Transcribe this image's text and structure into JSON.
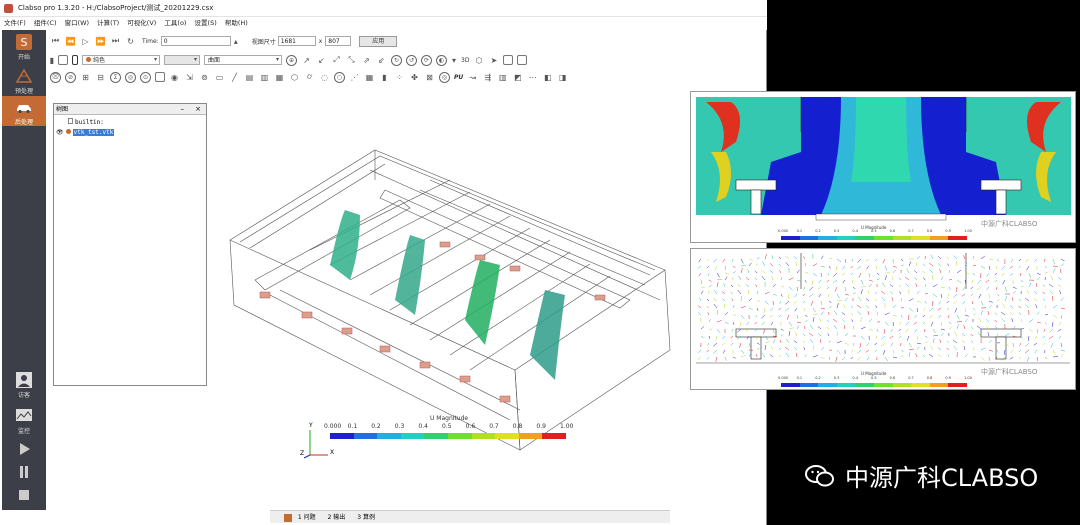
{
  "window": {
    "title": "Clabso pro 1.3.20 - H:/ClabsoProject/测试_20201229.csx"
  },
  "menu": [
    "文件(F)",
    "组件(C)",
    "窗口(W)",
    "计算(T)",
    "可视化(V)",
    "工具(o)",
    "设置(S)",
    "帮助(H)"
  ],
  "dock": {
    "items": [
      {
        "label": "开始",
        "icon": "logo-icon"
      },
      {
        "label": "预处理",
        "icon": "mesh-icon"
      },
      {
        "label": "后处理",
        "icon": "car-icon"
      },
      {
        "label": "访客",
        "icon": "user-icon"
      },
      {
        "label": "监控",
        "icon": "monitor-icon"
      }
    ],
    "active_index": 2
  },
  "toolbar": {
    "time_label": "Time:",
    "time_value": "0",
    "viewsize_label": "视图尺寸",
    "width_value": "1681",
    "x_label": "x",
    "height_value": "807",
    "apply_label": "应用",
    "color_mode": "纯色",
    "surface_mode": "曲面",
    "view3d_label": "3D",
    "pu_label": "PU"
  },
  "tree": {
    "title": "树图",
    "minimize": "–",
    "close": "×",
    "items": [
      "builtin:",
      "vtk_tst.vtk"
    ]
  },
  "colorbar": {
    "title": "U Magnitude",
    "ticks": [
      "0.000",
      "0.1",
      "0.2",
      "0.3",
      "0.4",
      "0.5",
      "0.6",
      "0.7",
      "0.8",
      "0.9",
      "1.00"
    ],
    "colors": [
      "#1f1fd0",
      "#1f6fe0",
      "#20b0e0",
      "#20d0c0",
      "#30d070",
      "#70e030",
      "#b0e020",
      "#e0e020",
      "#f0a020",
      "#e02020"
    ]
  },
  "axes": {
    "y": "Y",
    "z": "Z",
    "x": "X"
  },
  "statusbar": {
    "items": [
      "1 问题",
      "2 输出",
      "3 算例"
    ]
  },
  "inset_top": {
    "colorbar_title": "U Magnitude",
    "ticks": [
      "0.000",
      "0.1",
      "0.2",
      "0.3",
      "0.4",
      "0.5",
      "0.6",
      "0.7",
      "0.8",
      "0.9",
      "1.00"
    ],
    "watermark": "中源广科CLABSO"
  },
  "inset_bottom": {
    "colorbar_title": "U Magnitude",
    "ticks": [
      "0.000",
      "0.1",
      "0.2",
      "0.3",
      "0.4",
      "0.5",
      "0.6",
      "0.7",
      "0.8",
      "0.9",
      "1.00"
    ],
    "watermark": "中源广科CLABSO"
  },
  "brand_watermark": "中源广科CLABSO"
}
